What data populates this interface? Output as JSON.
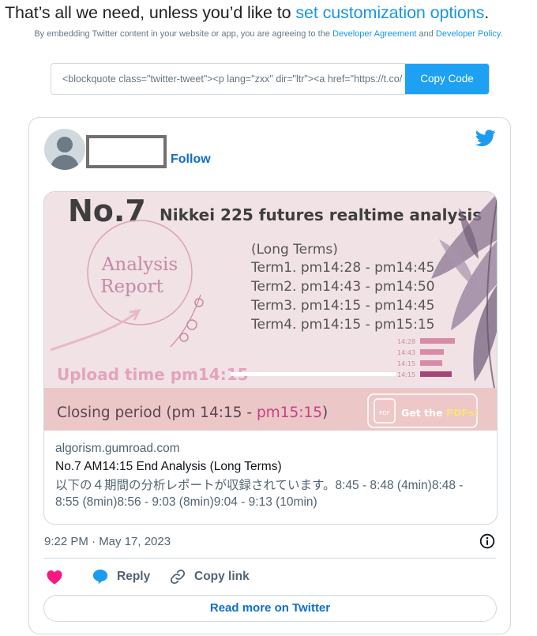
{
  "header": {
    "heading_prefix": "That’s all we need, unless you’d like to ",
    "heading_link": "set customization options",
    "heading_suffix": ".",
    "legal_prefix": "By embedding Twitter content in your website or app, you are agreeing to the ",
    "legal_link1": "Developer Agreement",
    "legal_mid": " and ",
    "legal_link2": "Developer Policy",
    "legal_suffix": "."
  },
  "embed": {
    "code": "<blockquote class=\"twitter-tweet\"><p lang=\"zxx\" dir=\"ltr\"><a href=\"https://t.co/",
    "copy_label": "Copy Code"
  },
  "tweet": {
    "follow_label": "Follow",
    "timestamp": "9:22 PM · May 17, 2023",
    "card": {
      "domain": "algorism.gumroad.com",
      "title": "No.7 AM14:15 End Analysis (Long Terms)",
      "description": "以下の４期間の分析レポートが収録されています。8:45 - 8:48 (4min)8:48 - 8:55 (8min)8:56 - 9:03 (8min)9:04 - 9:13 (10min)",
      "image": {
        "number": "No.7",
        "headline": "Nikkei 225 futures realtime analysis",
        "badge_line1": "Analysis",
        "badge_line2": "Report",
        "terms_header": "(Long Terms)",
        "terms": [
          "Term1. pm14:28 - pm14:45",
          "Term2. pm14:43 - pm14:50",
          "Term3. pm14:15 - pm14:45",
          "Term4. pm14:15 - pm15:15"
        ],
        "bar_labels": [
          "14:28",
          "14:43",
          "14:15",
          "14:15"
        ],
        "upload": "Upload time pm14:15",
        "closing_prefix": "Closing period  (pm 14:15 - ",
        "closing_highlight": "pm15:15",
        "closing_suffix": ")",
        "pdf_badge": "PDF",
        "cta_prefix": "Get the ",
        "cta_highlight": "PDFs!"
      }
    },
    "actions": {
      "like_count": "",
      "reply_label": "Reply",
      "copy_label": "Copy link"
    },
    "read_more_label": "Read more on Twitter"
  },
  "colors": {
    "link": "#1b95e0",
    "twitter_blue": "#1d9bf0",
    "follow": "#0f6fc6",
    "like_pink": "#f91880"
  },
  "icons": [
    "twitter-bird-icon",
    "info-icon",
    "heart-icon",
    "reply-bubble-icon",
    "link-icon"
  ]
}
